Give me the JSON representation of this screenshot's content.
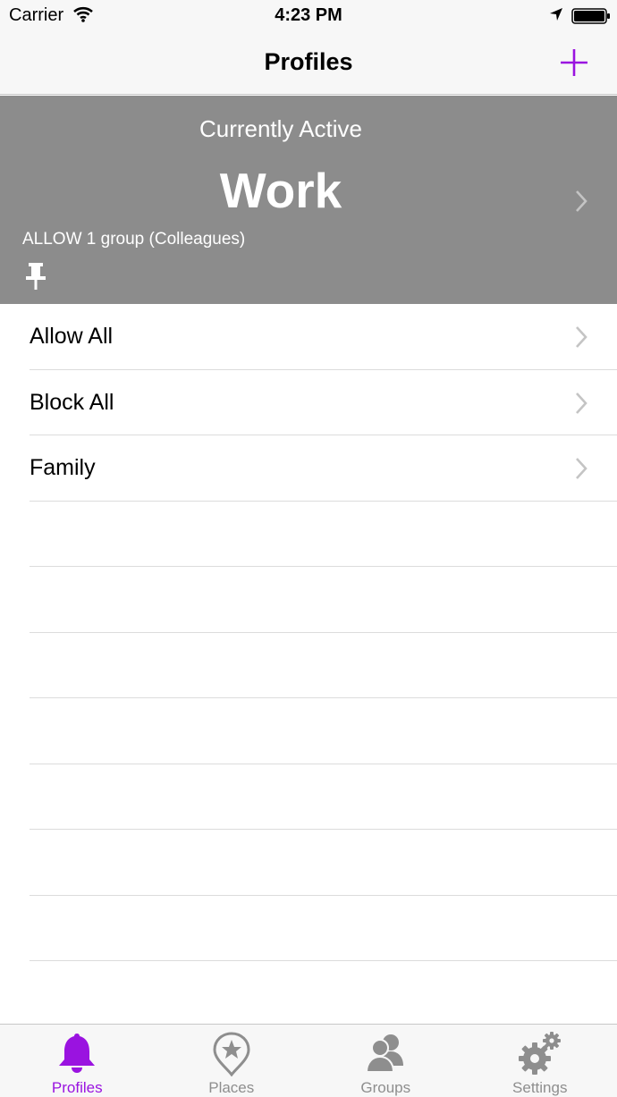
{
  "status_bar": {
    "carrier": "Carrier",
    "time": "4:23 PM"
  },
  "nav": {
    "title": "Profiles",
    "add_icon": "plus-icon"
  },
  "active_profile": {
    "caption": "Currently Active",
    "name": "Work",
    "rule": "ALLOW 1 group (Colleagues)",
    "pinned": true
  },
  "profiles": [
    {
      "label": "Allow All"
    },
    {
      "label": "Block All"
    },
    {
      "label": "Family"
    }
  ],
  "tabs": [
    {
      "label": "Profiles",
      "icon": "bell-icon",
      "active": true
    },
    {
      "label": "Places",
      "icon": "place-star-icon",
      "active": false
    },
    {
      "label": "Groups",
      "icon": "group-icon",
      "active": false
    },
    {
      "label": "Settings",
      "icon": "gears-icon",
      "active": false
    }
  ],
  "colors": {
    "accent": "#9a13e0",
    "banner": "#8c8c8c",
    "tab_inactive": "#8e8e8e",
    "bar_background": "#f7f7f7"
  }
}
